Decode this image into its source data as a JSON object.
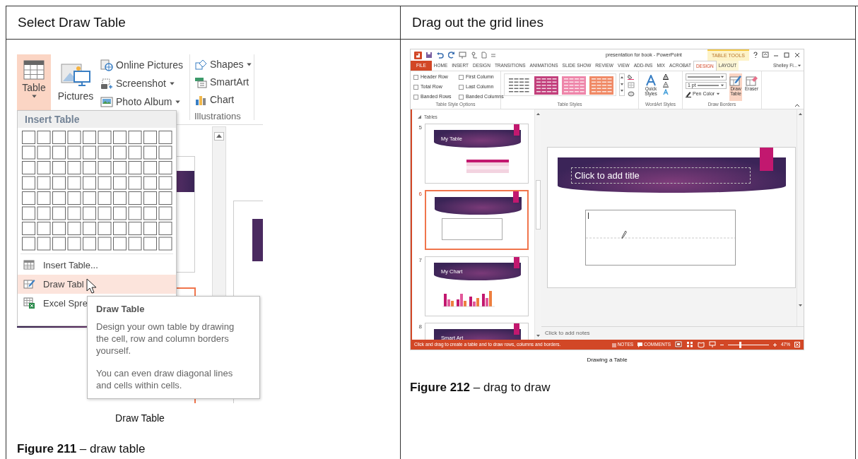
{
  "document_table": {
    "headings": [
      "Select Draw Table",
      "Drag out the grid lines"
    ]
  },
  "left_figure": {
    "large_buttons": [
      {
        "label": "Table",
        "selected": true,
        "dropdown": true
      },
      {
        "label": "Pictures",
        "selected": false
      }
    ],
    "image_buttons": [
      {
        "label": "Online Pictures"
      },
      {
        "label": "Screenshot",
        "dropdown": true
      },
      {
        "label": "Photo Album",
        "dropdown": true
      }
    ],
    "illustration_buttons": [
      {
        "label": "Shapes",
        "dropdown": true
      },
      {
        "label": "SmartArt"
      },
      {
        "label": "Chart"
      }
    ],
    "group_label": "Illustrations",
    "menu": {
      "header": "Insert Table",
      "items": [
        {
          "label": "Insert Table...",
          "selected": false
        },
        {
          "label": "Draw Tabl",
          "selected": true
        },
        {
          "label": "Excel Spre",
          "selected": false
        }
      ]
    },
    "tooltip": {
      "title": "Draw Table",
      "paragraphs": [
        "Design your own table by drawing the cell, row and column borders yourself.",
        "You can even draw diagonal lines and cells within cells."
      ]
    },
    "caption": "Draw Table",
    "figure_caption": "**Figure 211** – draw table"
  },
  "right_figure": {
    "window": {
      "title": "presentation for book - PowerPoint",
      "contextual_header": "TABLE TOOLS",
      "user": "Shelley Fi..."
    },
    "tabs": [
      {
        "label": "FILE",
        "kind": "file",
        "selected": false
      },
      {
        "label": "HOME",
        "kind": "tab",
        "selected": false
      },
      {
        "label": "INSERT",
        "kind": "tab",
        "selected": false
      },
      {
        "label": "DESIGN",
        "kind": "tab",
        "selected": false
      },
      {
        "label": "TRANSITIONS",
        "kind": "tab",
        "selected": false
      },
      {
        "label": "ANIMATIONS",
        "kind": "tab",
        "selected": false
      },
      {
        "label": "SLIDE SHOW",
        "kind": "tab",
        "selected": false
      },
      {
        "label": "REVIEW",
        "kind": "tab",
        "selected": false
      },
      {
        "label": "VIEW",
        "kind": "tab",
        "selected": false
      },
      {
        "label": "ADD-INS",
        "kind": "tab",
        "selected": false
      },
      {
        "label": "MIX",
        "kind": "tab",
        "selected": false
      },
      {
        "label": "ACROBAT",
        "kind": "tab",
        "selected": false
      },
      {
        "label": "DESIGN",
        "kind": "contextual",
        "selected": true
      },
      {
        "label": "LAYOUT",
        "kind": "contextual",
        "selected": false
      }
    ],
    "style_options": [
      {
        "label": "Header Row",
        "checked": false
      },
      {
        "label": "First Column",
        "checked": false
      },
      {
        "label": "Total Row",
        "checked": false
      },
      {
        "label": "Last Column",
        "checked": false
      },
      {
        "label": "Banded Rows",
        "checked": false
      },
      {
        "label": "Banded Columns",
        "checked": false
      }
    ],
    "table_styles": [
      {
        "color": "#ffffff"
      },
      {
        "color": "#c2407c"
      },
      {
        "color": "#ee86aa"
      },
      {
        "color": "#f08a66"
      }
    ],
    "quick_styles": "Quick Styles",
    "pen_weight": "1 pt",
    "pen_color": "Pen Color",
    "draw_buttons": [
      {
        "label": "Draw Table",
        "selected": true
      },
      {
        "label": "Eraser",
        "selected": false
      }
    ],
    "groups": [
      "Table Style Options",
      "Table Styles",
      "WordArt Styles",
      "Draw Borders"
    ],
    "slide_pane": {
      "section": "Tables",
      "slides": [
        {
          "number": "5",
          "title": "My Table",
          "kind": "table",
          "selected": false
        },
        {
          "number": "6",
          "kind": "blank",
          "selected": true
        },
        {
          "number": "7",
          "title": "My Chart",
          "kind": "chart",
          "selected": false
        },
        {
          "number": "8",
          "title": "Smart Art",
          "kind": "title",
          "selected": false
        }
      ]
    },
    "slide": {
      "title_placeholder": "Click to add title"
    },
    "notes_placeholder": "Click to add notes",
    "status_bar": {
      "message": "Click and drag to create a table and to draw rows, columns and borders.",
      "notes": "NOTES",
      "comments": "COMMENTS",
      "zoom": {
        "level": 0.3,
        "reading": "47%"
      }
    },
    "caption": "Drawing a Table",
    "figure_caption": "**Figure 212** – drag to draw"
  }
}
